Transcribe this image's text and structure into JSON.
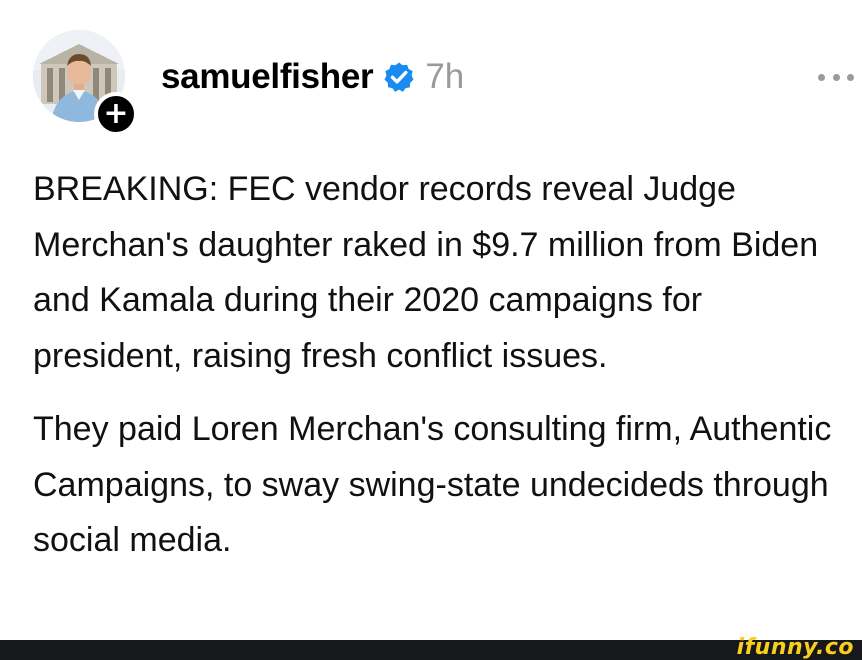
{
  "post": {
    "username": "samuelfisher",
    "timestamp": "7h",
    "verified": true,
    "paragraphs": [
      "BREAKING: FEC vendor records reveal Judge Merchan's daughter raked in $9.7 million from Biden and Kamala during their 2020 campaigns for president, raising fresh conflict issues.",
      "They paid Loren Merchan's consulting firm, Authentic Campaigns, to sway swing-state undecideds through social media."
    ]
  },
  "avatar": {
    "follow_symbol": "+"
  },
  "icons": {
    "verified": "verified-badge-icon",
    "more": "more-options-icon",
    "follow": "plus-icon"
  },
  "watermark": {
    "text": "ifunny.co"
  },
  "colors": {
    "verified_blue": "#1a8cf0",
    "timestamp_gray": "#9a9a9a",
    "watermark_yellow": "#f9cf1b",
    "footer_bar": "#17181c"
  }
}
